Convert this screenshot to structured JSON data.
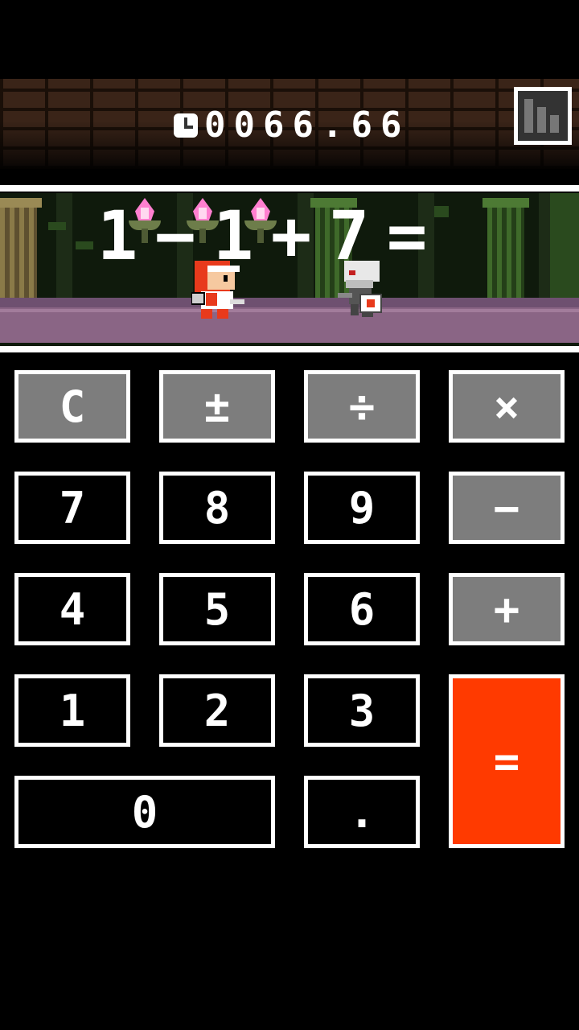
{
  "timer": {
    "icon": "clock-icon",
    "value": "0066.66"
  },
  "stats_button": {
    "icon": "bar-chart-icon"
  },
  "equation": [
    "1",
    "−",
    "1",
    "+",
    "7",
    "="
  ],
  "keys": {
    "clear": "C",
    "sign": "±",
    "divide": "÷",
    "multiply": "×",
    "seven": "7",
    "eight": "8",
    "nine": "9",
    "minus": "−",
    "four": "4",
    "five": "5",
    "six": "6",
    "plus": "+",
    "one": "1",
    "two": "2",
    "three": "3",
    "equals": "=",
    "zero": "0",
    "decimal": "."
  },
  "colors": {
    "equals_key": "#ff3a00",
    "operator_key": "#7d7d7d",
    "digit_key": "#000000",
    "torch_flame": "#ff7fd0",
    "floor": "#8a6585"
  }
}
